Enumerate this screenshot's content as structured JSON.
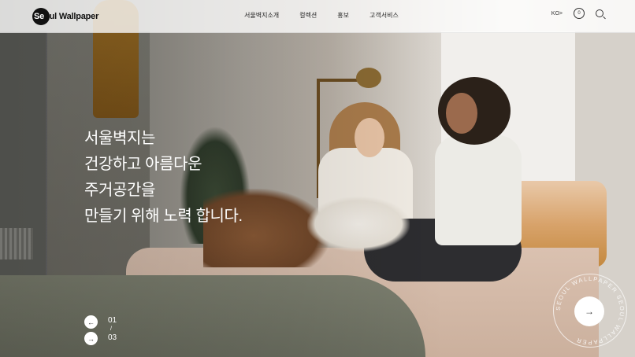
{
  "brand": {
    "logo_first": "Se",
    "logo_rest": "oul Wallpaper"
  },
  "nav": {
    "items": [
      {
        "label": "서울벽지소개"
      },
      {
        "label": "컬렉션"
      },
      {
        "label": "홍보"
      },
      {
        "label": "고객서비스"
      }
    ]
  },
  "util": {
    "lang": "KO>",
    "cart_count": "0"
  },
  "hero": {
    "lines": [
      "서울벽지는",
      "건강하고 아름다운",
      "주거공간을",
      "만들기 위해 노력 합니다."
    ]
  },
  "slider": {
    "current": "01",
    "separator": "/",
    "total": "03",
    "prev_icon": "arrow-left-icon",
    "next_icon": "arrow-right-icon"
  },
  "badge": {
    "text": "SEOUL WALLPAPER SEOUL WALLPAPER "
  },
  "colors": {
    "header_bg": "#ffffff",
    "text_dark": "#111111",
    "accent_white": "#ffffff"
  }
}
